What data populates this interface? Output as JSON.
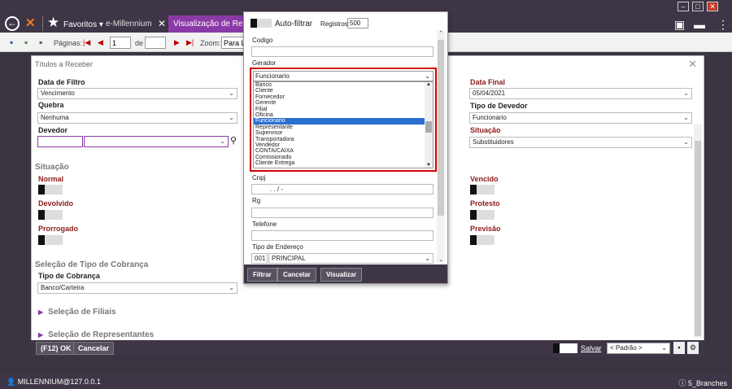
{
  "titlebar": {
    "favorites_label": "Favoritos",
    "tabs": [
      {
        "label": "e-Millennium"
      },
      {
        "label": "Visualização de Relatórios"
      }
    ]
  },
  "toolbar": {
    "pages_label": "Páginas:",
    "page_value": "1",
    "of_label": "de",
    "total_pages": "",
    "zoom_label": "Zoom:",
    "zoom_value": "Para La"
  },
  "dialog": {
    "title": "Títulos a Receber",
    "data_filtro_label": "Data de Filtro",
    "data_filtro_value": "Vencimento",
    "quebra_label": "Quebra",
    "quebra_value": "Nenhuma",
    "devedor_label": "Devedor",
    "data_final_label": "Data Final",
    "data_final_value": "05/04/2021",
    "tipo_devedor_label": "Tipo de Devedor",
    "tipo_devedor_value": "Funcionario",
    "situacao_right_label": "Situação",
    "situacao_right_value": "Substituidores",
    "situacao_section": "Situação",
    "toggles_left": [
      "Normal",
      "Devolvido",
      "Prorrogado"
    ],
    "toggles_right": [
      "Vencido",
      "Protesto",
      "Previsão"
    ],
    "cobranca_section": "Seleção de Tipo de Cobrança",
    "tipo_cobranca_label": "Tipo de Cobrança",
    "tipo_cobranca_value": "Banco/Carteira",
    "expander_filiais": "Seleção de Filiais",
    "expander_representantes": "Seleção de Representantes"
  },
  "bottombar": {
    "ok_label": "(F12) OK",
    "cancel_label": "Cancelar",
    "save_label": "Salvar",
    "default_select": "< Padrão >"
  },
  "popup": {
    "autofiltrar_label": "Auto-filtrar",
    "registros_label": "Registros:",
    "registros_value": "500",
    "codigo_label": "Codigo",
    "gerador_label": "Gerador",
    "gerador_value": "Funcionario",
    "gerador_options": [
      "Banco",
      "Cliente",
      "Fornecedor",
      "Gerente",
      "Filial",
      "Oficina",
      "Funcionario",
      "Representante",
      "Supervisor",
      "Transportadora",
      "Vendedor",
      "CONTA/CAIXA",
      "Comissionado",
      "Cliente Entrega"
    ],
    "gerador_selected_index": 6,
    "cnpj_label": "Cnpj",
    "cnpj_value": ". . / -",
    "rg_label": "Rg",
    "telefone_label": "Telefone",
    "tipo_endereco_label": "Tipo de Endereço",
    "tipo_endereco_code": "001",
    "tipo_endereco_value": "PRINCIPAL",
    "filtrar_label": "Filtrar",
    "cancelar_label": "Cancelar",
    "visualizar_label": "Visualizar"
  },
  "status": {
    "user": "MILLENNIUM@127.0.0.1",
    "branch": "5_Branches"
  },
  "colors": {
    "accent": "#8a3aa6",
    "chrome": "#3e3646",
    "highlight_border": "#d80000",
    "selection": "#2b6fd1"
  }
}
